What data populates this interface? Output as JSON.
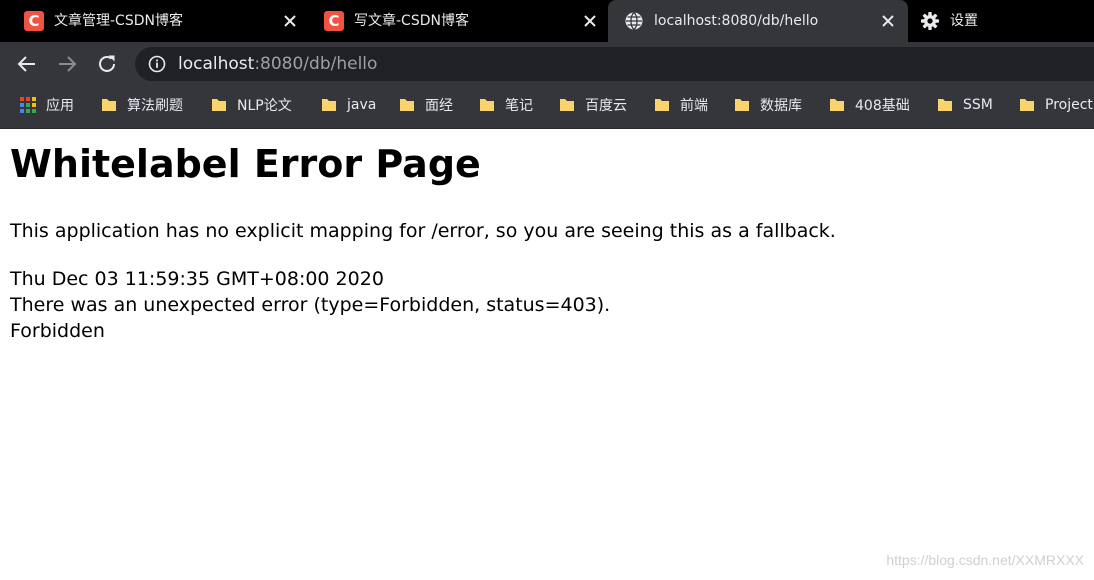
{
  "colors": {
    "tabstrip_bg": "#000000",
    "toolbar_bg": "#35363a",
    "omnibox_bg": "#202124",
    "tab_text": "#e8eaed",
    "csdn_red": "#f0533f",
    "folder_yellow": "#f9d36b"
  },
  "tabs": [
    {
      "title": "文章管理-CSDN博客",
      "favicon": "csdn-logo",
      "active": false
    },
    {
      "title": "写文章-CSDN博客",
      "favicon": "csdn-logo",
      "active": false
    },
    {
      "title": "localhost:8080/db/hello",
      "favicon": "globe-icon",
      "active": true
    },
    {
      "title": "设置",
      "favicon": "gear-icon",
      "active": false
    }
  ],
  "favicon_letter": "C",
  "address_bar": {
    "host": "localhost",
    "rest": ":8080/db/hello"
  },
  "bookmarks": {
    "apps_label": "应用",
    "items": [
      "算法刷题",
      "NLP论文",
      "java",
      "面经",
      "笔记",
      "百度云",
      "前端",
      "数据库",
      "408基础",
      "SSM",
      "Project"
    ]
  },
  "page": {
    "heading": "Whitelabel Error Page",
    "message": "This application has no explicit mapping for /error, so you are seeing this as a fallback.",
    "timestamp": "Thu Dec 03 11:59:35 GMT+08:00 2020",
    "error_detail": "There was an unexpected error (type=Forbidden, status=403).",
    "error_reason": "Forbidden"
  },
  "watermark": "https://blog.csdn.net/XXMRXXX"
}
